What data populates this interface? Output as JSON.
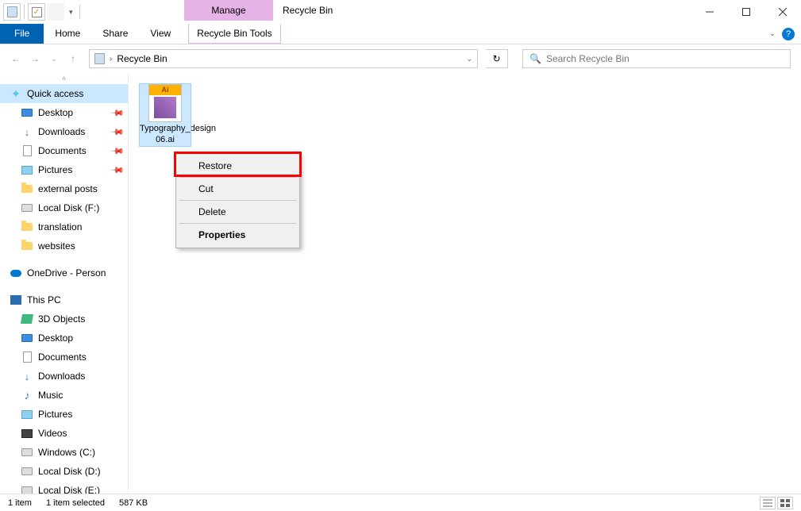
{
  "window": {
    "title": "Recycle Bin"
  },
  "ctx_tab": {
    "top": "Manage",
    "bottom": "Recycle Bin Tools"
  },
  "tabs": {
    "file": "File",
    "home": "Home",
    "share": "Share",
    "view": "View"
  },
  "addr": {
    "location": "Recycle Bin"
  },
  "search": {
    "placeholder": "Search Recycle Bin"
  },
  "sidebar": {
    "quick": "Quick access",
    "desktop": "Desktop",
    "downloads": "Downloads",
    "documents": "Documents",
    "pictures": "Pictures",
    "external": "external posts",
    "localf": "Local Disk (F:)",
    "translation": "translation",
    "websites": "websites",
    "onedrive": "OneDrive - Person",
    "thispc": "This PC",
    "objects3d": "3D Objects",
    "desktop2": "Desktop",
    "documents2": "Documents",
    "downloads2": "Downloads",
    "music": "Music",
    "pictures2": "Pictures",
    "videos": "Videos",
    "winc": "Windows (C:)",
    "locald": "Local Disk (D:)",
    "locale": "Local Disk (E:)"
  },
  "file": {
    "name": "Typography_design 06.ai",
    "badge": "Ai"
  },
  "context_menu": {
    "restore": "Restore",
    "cut": "Cut",
    "delete": "Delete",
    "properties": "Properties"
  },
  "status": {
    "count": "1 item",
    "selected": "1 item selected",
    "size": "587 KB"
  }
}
